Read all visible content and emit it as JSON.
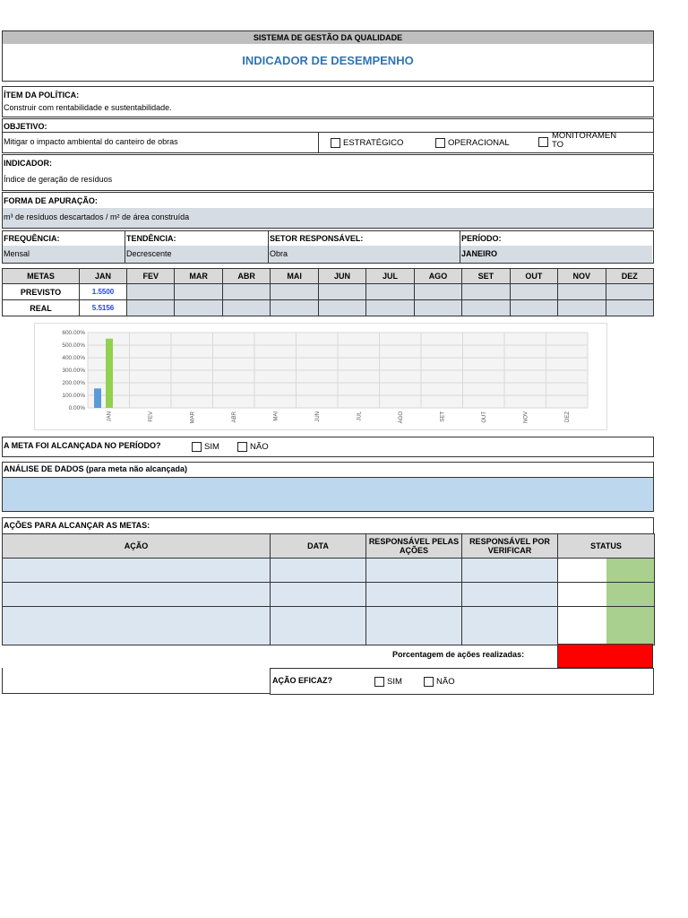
{
  "header": {
    "system": "SISTEMA DE GESTÃO DA QUALIDADE",
    "title": "INDICADOR DE DESEMPENHO"
  },
  "policy": {
    "label": "ÍTEM DA POLÍTICA:",
    "value": "Construir com rentabilidade e sustentabilidade."
  },
  "objective": {
    "label": "OBJETIVO:",
    "value": "Mitigar o impacto ambiental do canteiro de obras",
    "options": [
      "ESTRATÉGICO",
      "OPERACIONAL",
      "MONITORAMENTO"
    ]
  },
  "indicator": {
    "label": "INDICADOR:",
    "value": "Índice de geração de resíduos"
  },
  "method": {
    "label": "FORMA DE APURAÇÃO:",
    "value": "m³ de resíduos descartados / m² de área construída"
  },
  "info": [
    {
      "label": "FREQUÊNCIA:",
      "value": "Mensal"
    },
    {
      "label": "TENDÊNCIA:",
      "value": "Decrescente"
    },
    {
      "label": "SETOR RESPONSÁVEL:",
      "value": "Obra"
    },
    {
      "label": "PERÍODO:",
      "value": "JANEIRO"
    }
  ],
  "metas": {
    "header": "METAS",
    "months": [
      "JAN",
      "FEV",
      "MAR",
      "ABR",
      "MAI",
      "JUN",
      "JUL",
      "AGO",
      "SET",
      "OUT",
      "NOV",
      "DEZ"
    ],
    "previsto_label": "PREVISTO",
    "real_label": "REAL",
    "previsto": [
      "1.5500"
    ],
    "real": [
      "5.5156"
    ]
  },
  "chart_data": {
    "type": "bar",
    "categories": [
      "JAN",
      "FEV",
      "MAR",
      "ABR",
      "MAI",
      "JUN",
      "JUL",
      "AGO",
      "SET",
      "OUT",
      "NOV",
      "DEZ"
    ],
    "series": [
      {
        "name": "PREVISTO",
        "color": "#5b9bd5",
        "values": [
          155,
          null,
          null,
          null,
          null,
          null,
          null,
          null,
          null,
          null,
          null,
          null
        ]
      },
      {
        "name": "REAL",
        "color": "#92d050",
        "values": [
          551.56,
          null,
          null,
          null,
          null,
          null,
          null,
          null,
          null,
          null,
          null,
          null
        ]
      }
    ],
    "yticks": [
      "0.00%",
      "100.00%",
      "200.00%",
      "300.00%",
      "400.00%",
      "500.00%",
      "600.00%"
    ],
    "ylim": [
      0,
      600
    ]
  },
  "goal": {
    "question": "A META FOI ALCANÇADA NO PERÍODO?",
    "yes": "SIM",
    "no": "NÃO"
  },
  "analysis": {
    "label": "ANÁLISE DE DADOS (para meta não alcançada)"
  },
  "actions": {
    "label": "AÇÕES PARA ALCANÇAR AS METAS:",
    "columns": [
      "AÇÃO",
      "DATA",
      "RESPONSÁVEL PELAS AÇÕES",
      "RESPONSÁVEL POR VERIFICAR",
      "STATUS"
    ],
    "percent_label": "Porcentagem de ações realizadas:",
    "effective_label": "AÇÃO EFICAZ?",
    "yes": "SIM",
    "no": "NÃO"
  },
  "colors": {
    "title": "#2e75b6",
    "status_done": "#a9d08e",
    "percent": "#ff0000"
  }
}
